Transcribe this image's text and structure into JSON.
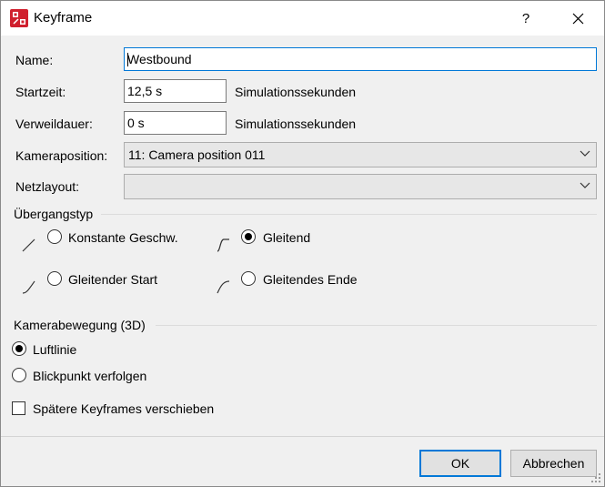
{
  "window": {
    "title": "Keyframe",
    "help_label": "?",
    "icon": "app-logo-icon"
  },
  "form": {
    "name_label": "Name:",
    "name_value": "Westbound",
    "start_label": "Startzeit:",
    "start_value": "12,5 s",
    "start_unit": "Simulationssekunden",
    "dwell_label": "Verweildauer:",
    "dwell_value": "0 s",
    "dwell_unit": "Simulationssekunden",
    "camera_label": "Kameraposition:",
    "camera_value": "11: Camera position 011",
    "net_label": "Netzlayout:",
    "net_value": ""
  },
  "transition": {
    "label": "Übergangstyp",
    "options": [
      {
        "label": "Konstante Geschw.",
        "checked": false,
        "icon": "linear-curve-icon"
      },
      {
        "label": "Gleitend",
        "checked": true,
        "icon": "smooth-curve-icon"
      },
      {
        "label": "Gleitender Start",
        "checked": false,
        "icon": "ease-in-curve-icon"
      },
      {
        "label": "Gleitendes Ende",
        "checked": false,
        "icon": "ease-out-curve-icon"
      }
    ]
  },
  "camera_motion": {
    "label": "Kamerabewegung (3D)",
    "options": [
      {
        "label": "Luftlinie",
        "checked": true
      },
      {
        "label": "Blickpunkt verfolgen",
        "checked": false
      }
    ]
  },
  "shift_keyframes": {
    "label": "Spätere Keyframes verschieben",
    "checked": false
  },
  "buttons": {
    "ok": "OK",
    "cancel": "Abbrechen"
  }
}
